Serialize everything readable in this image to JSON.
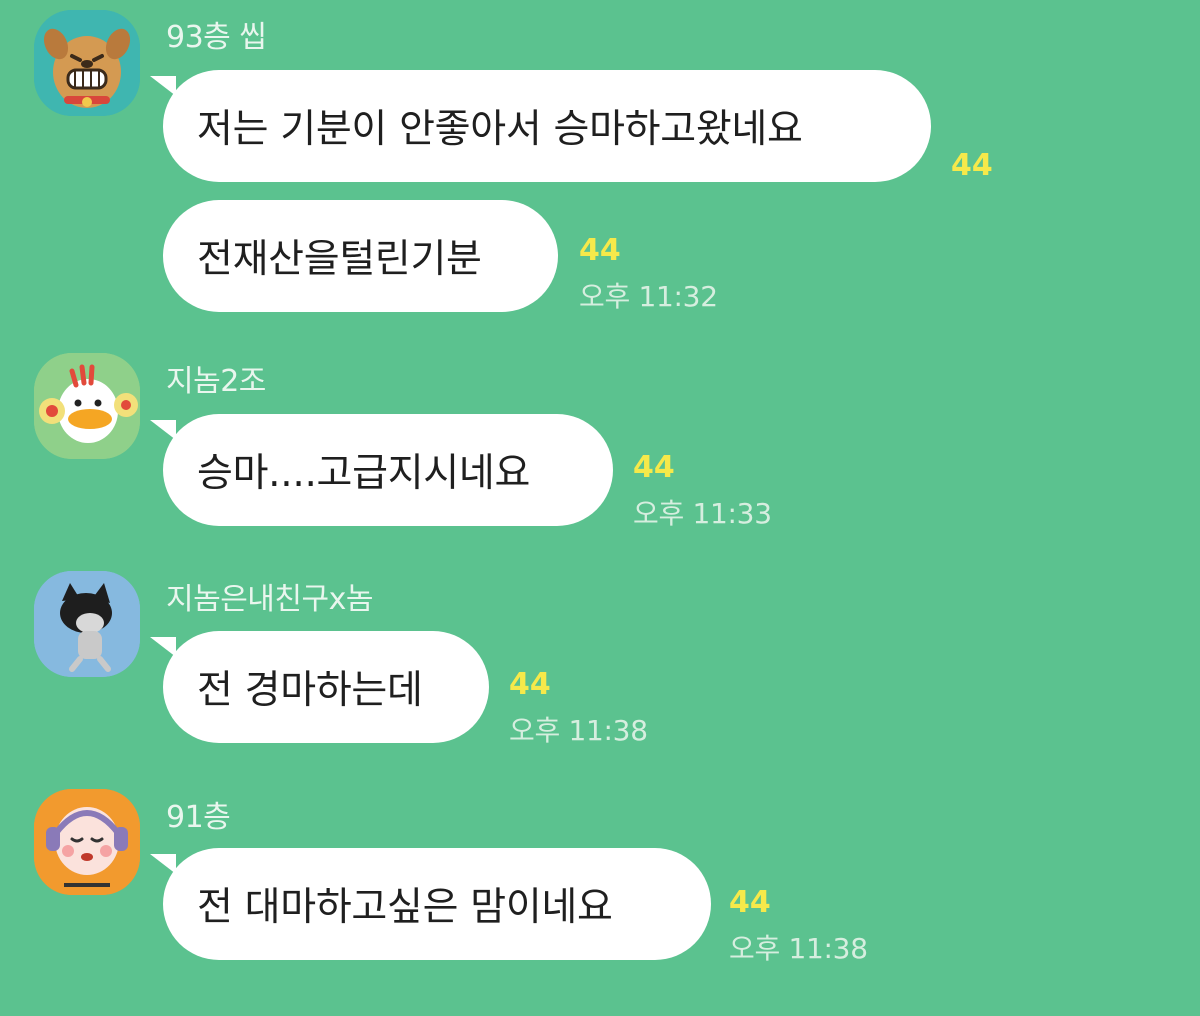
{
  "messages": [
    {
      "sender": "93층 씹",
      "avatar_icon": "dog-character-icon",
      "bubbles": [
        {
          "text": "저는 기분이 안좋아서 승마하고왔네요",
          "unread": "44",
          "time": ""
        },
        {
          "text": "전재산을털린기분",
          "unread": "44",
          "time": "오후 11:32"
        }
      ]
    },
    {
      "sender": "지놈2조",
      "avatar_icon": "duck-cheerleader-icon",
      "bubbles": [
        {
          "text": "승마....고급지시네요",
          "unread": "44",
          "time": "오후 11:33"
        }
      ]
    },
    {
      "sender": "지놈은내친구x놈",
      "avatar_icon": "cat-character-icon",
      "bubbles": [
        {
          "text": "전 경마하는데",
          "unread": "44",
          "time": "오후 11:38"
        }
      ]
    },
    {
      "sender": "91층",
      "avatar_icon": "peach-headphones-icon",
      "bubbles": [
        {
          "text": "전 대마하고싶은 맘이네요",
          "unread": "44",
          "time": "오후 11:38"
        }
      ]
    }
  ],
  "colors": {
    "background": "#5bc28f",
    "bubble": "#ffffff",
    "unread": "#f6e94a"
  }
}
